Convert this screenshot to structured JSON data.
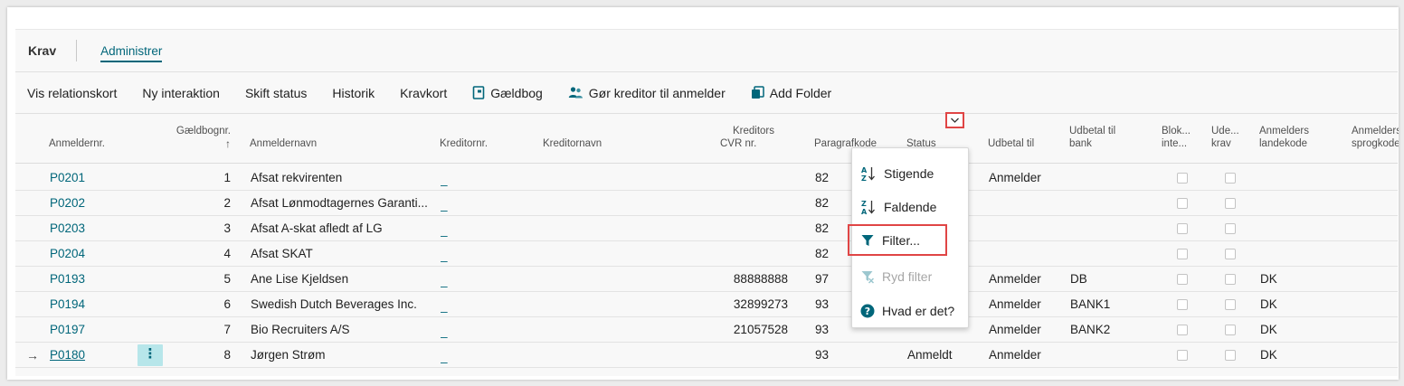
{
  "tabs": {
    "title": "Krav",
    "active": "Administrer"
  },
  "actions": [
    {
      "label": "Vis relationskort"
    },
    {
      "label": "Ny interaktion"
    },
    {
      "label": "Skift status"
    },
    {
      "label": "Historik"
    },
    {
      "label": "Kravkort"
    },
    {
      "label": "Gældbog",
      "icon": "ledger-book-icon"
    },
    {
      "label": "Gør kreditor til anmelder",
      "icon": "users-icon"
    },
    {
      "label": "Add Folder",
      "icon": "copy-folder-icon"
    }
  ],
  "columns": {
    "anmeldernr": "Anmeldernr.",
    "gaeldbognr": "Gældbognr.",
    "sort_arrow": "↑",
    "anmeldernavn": "Anmeldernavn",
    "kreditornr": "Kreditornr.",
    "kreditornavn": "Kreditornavn",
    "cvr_1": "Kreditors",
    "cvr_2": "CVR nr.",
    "paragrafkode": "Paragrafkode",
    "status": "Status",
    "udbetal_til": "Udbetal til",
    "udbetal_bank_1": "Udbetal til",
    "udbetal_bank_2": "bank",
    "blok_1": "Blok...",
    "blok_2": "inte...",
    "ude_1": "Ude...",
    "ude_2": "krav",
    "landekode_1": "Anmelders",
    "landekode_2": "landekode",
    "sprogkode_1": "Anmelders",
    "sprogkode_2": "sprogkode"
  },
  "rows": [
    {
      "anmeldernr": "P0201",
      "gaeldbognr": "1",
      "anmeldernavn": "Afsat rekvirenten",
      "kreditornr": "_",
      "cvr": "",
      "paragrafkode": "82",
      "status": "",
      "udbetal_til": "Anmelder",
      "bank": "",
      "landekode": ""
    },
    {
      "anmeldernr": "P0202",
      "gaeldbognr": "2",
      "anmeldernavn": "Afsat Lønmodtagernes Garanti...",
      "kreditornr": "_",
      "cvr": "",
      "paragrafkode": "82",
      "status": "",
      "udbetal_til": "",
      "bank": "",
      "landekode": ""
    },
    {
      "anmeldernr": "P0203",
      "gaeldbognr": "3",
      "anmeldernavn": "Afsat A-skat afledt af LG",
      "kreditornr": "_",
      "cvr": "",
      "paragrafkode": "82",
      "status": "",
      "udbetal_til": "",
      "bank": "",
      "landekode": ""
    },
    {
      "anmeldernr": "P0204",
      "gaeldbognr": "4",
      "anmeldernavn": "Afsat SKAT",
      "kreditornr": "_",
      "cvr": "",
      "paragrafkode": "82",
      "status": "",
      "udbetal_til": "",
      "bank": "",
      "landekode": ""
    },
    {
      "anmeldernr": "P0193",
      "gaeldbognr": "5",
      "anmeldernavn": "Ane Lise Kjeldsen",
      "kreditornr": "_",
      "cvr": "88888888",
      "paragrafkode": "97",
      "status": "",
      "udbetal_til": "Anmelder",
      "bank": "DB",
      "landekode": "DK"
    },
    {
      "anmeldernr": "P0194",
      "gaeldbognr": "6",
      "anmeldernavn": "Swedish Dutch Beverages Inc.",
      "kreditornr": "_",
      "cvr": "32899273",
      "paragrafkode": "93",
      "status": "",
      "udbetal_til": "Anmelder",
      "bank": "BANK1",
      "landekode": "DK"
    },
    {
      "anmeldernr": "P0197",
      "gaeldbognr": "7",
      "anmeldernavn": "Bio Recruiters A/S",
      "kreditornr": "_",
      "cvr": "21057528",
      "paragrafkode": "93",
      "status": "",
      "udbetal_til": "Anmelder",
      "bank": "BANK2",
      "landekode": "DK"
    },
    {
      "anmeldernr": "P0180",
      "gaeldbognr": "8",
      "anmeldernavn": "Jørgen Strøm",
      "kreditornr": "_",
      "cvr": "",
      "paragrafkode": "93",
      "status": "Anmeldt",
      "udbetal_til": "Anmelder",
      "bank": "",
      "landekode": "DK"
    }
  ],
  "selected_row": {
    "arrow": "→",
    "menu_glyph": "⋮"
  },
  "menu": {
    "items": [
      {
        "label": "Stigende",
        "icon": "sort-ascending-icon"
      },
      {
        "label": "Faldende",
        "icon": "sort-descending-icon"
      },
      {
        "label": "Filter...",
        "icon": "filter-icon"
      },
      {
        "label": "Ryd filter",
        "icon": "clear-filter-icon"
      },
      {
        "label": "Hvad er det?",
        "icon": "help-icon"
      }
    ]
  },
  "colors": {
    "accent": "#00667a",
    "highlight": "#e04545",
    "selected_bg": "#b7e6ea"
  }
}
